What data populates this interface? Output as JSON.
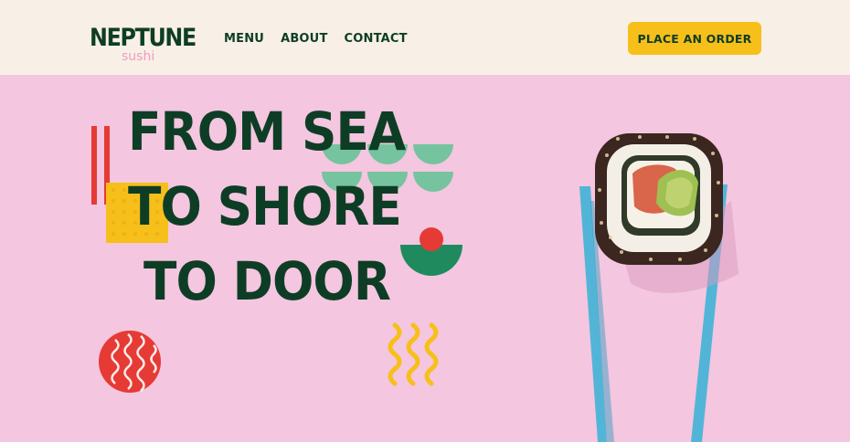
{
  "header": {
    "logo_main": "NEPTUNE",
    "logo_sub": "sushi",
    "nav": [
      "MENU",
      "ABOUT",
      "CONTACT"
    ],
    "cta_label": "PLACE AN ORDER"
  },
  "hero": {
    "headline_lines": [
      "FROM SEA",
      "TO SHORE",
      "TO DOOR"
    ]
  },
  "icons": {
    "chopsticks": "chopsticks-icon",
    "sushi": "sushi-roll-illustration",
    "waves": "wave-icon"
  },
  "colors": {
    "brand_green": "#0e3d26",
    "pink_bg": "#f4c6df",
    "header_bg": "#f8f0e6",
    "cta_yellow": "#f7bf1a",
    "accent_red": "#e63a35",
    "accent_mint": "#76c3a0",
    "chopstick_blue": "#52b5d8"
  }
}
